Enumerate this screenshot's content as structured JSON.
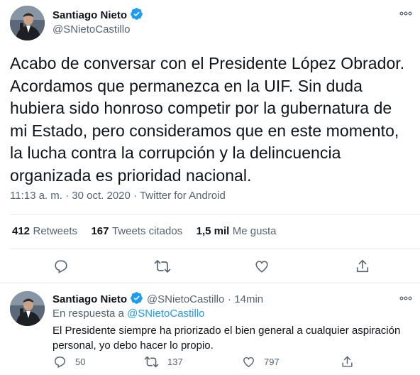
{
  "main_tweet": {
    "author_name": "Santiago Nieto",
    "author_handle": "@SNietoCastillo",
    "more_icon": "more-horizontal-icon",
    "text": "Acabo de conversar con el Presidente López Obrador. Acordamos que permanezca en la UIF. Sin duda hubiera sido honroso competir por la gubernatura de mi Estado, pero consideramos que en este momento, la lucha contra la corrupción y la delincuencia organizada es prioridad nacional.",
    "time": "11:13 a. m.",
    "separator": "·",
    "date": "30 oct. 2020",
    "source": "Twitter for Android",
    "stats": {
      "retweets_count": "412",
      "retweets_label": "Retweets",
      "quotes_count": "167",
      "quotes_label": "Tweets citados",
      "likes_count": "1,5 mil",
      "likes_label": "Me gusta"
    }
  },
  "reply_tweet": {
    "author_name": "Santiago Nieto",
    "author_handle": "@SNietoCastillo",
    "separator": "·",
    "time_ago": "14min",
    "in_reply_prefix": "En respuesta a",
    "in_reply_handle": "@SNietoCastillo",
    "text": "El Presidente siempre ha priorizado el bien general a cualquier aspiración personal, yo debo hacer lo propio.",
    "reply_count": "50",
    "retweet_count": "137",
    "like_count": "797"
  },
  "colors": {
    "accent": "#1d9bf0",
    "text": "#0f1419",
    "muted": "#536471",
    "divider": "#e6ecf0"
  }
}
